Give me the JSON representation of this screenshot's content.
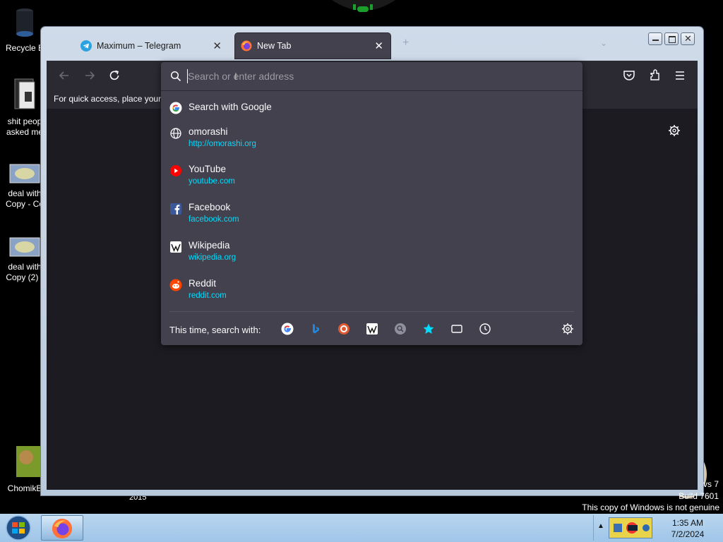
{
  "desktop": {
    "icons": [
      {
        "label": "Recycle B"
      },
      {
        "label": "shit peop",
        "label2": "asked me"
      },
      {
        "label": "deal with",
        "label2": "Copy - Co"
      },
      {
        "label": "deal with",
        "label2": "Copy (2) -"
      },
      {
        "label": "ChomikB"
      }
    ],
    "year_text": "2015",
    "watermark": {
      "line1": "vs 7",
      "line2": "Build 7601",
      "notice": "This copy of Windows is not genuine"
    }
  },
  "browser": {
    "tabs": [
      {
        "label": "Maximum – Telegram",
        "active": false
      },
      {
        "label": "New Tab",
        "active": true
      }
    ],
    "new_tab_symbol": "+",
    "bookmarks_hint": "For quick access, place your b",
    "urlbar": {
      "placeholder": "Search or enter address",
      "search_row": {
        "title": "Search with Google"
      },
      "suggestions": [
        {
          "title": "omorashi",
          "url": "http://omorashi.org",
          "icon": "globe-icon"
        },
        {
          "title": "YouTube",
          "url": "youtube.com",
          "icon": "youtube-icon"
        },
        {
          "title": "Facebook",
          "url": "facebook.com",
          "icon": "facebook-icon"
        },
        {
          "title": "Wikipedia",
          "url": "wikipedia.org",
          "icon": "wikipedia-icon"
        },
        {
          "title": "Reddit",
          "url": "reddit.com",
          "icon": "reddit-icon"
        }
      ],
      "oneoff_label": "This time, search with:",
      "oneoff_engines": [
        "google-icon",
        "bing-icon",
        "duckduckgo-icon",
        "wikipedia-icon",
        "search-engine-icon",
        "bookmarks-star-icon",
        "tabs-icon",
        "history-icon",
        "settings-gear-icon"
      ]
    },
    "colors": {
      "accent_url": "#00ddff",
      "panel": "#42414d",
      "page": "#1c1b22"
    }
  },
  "taskbar": {
    "time": "1:35 AM",
    "date": "7/2/2024"
  }
}
